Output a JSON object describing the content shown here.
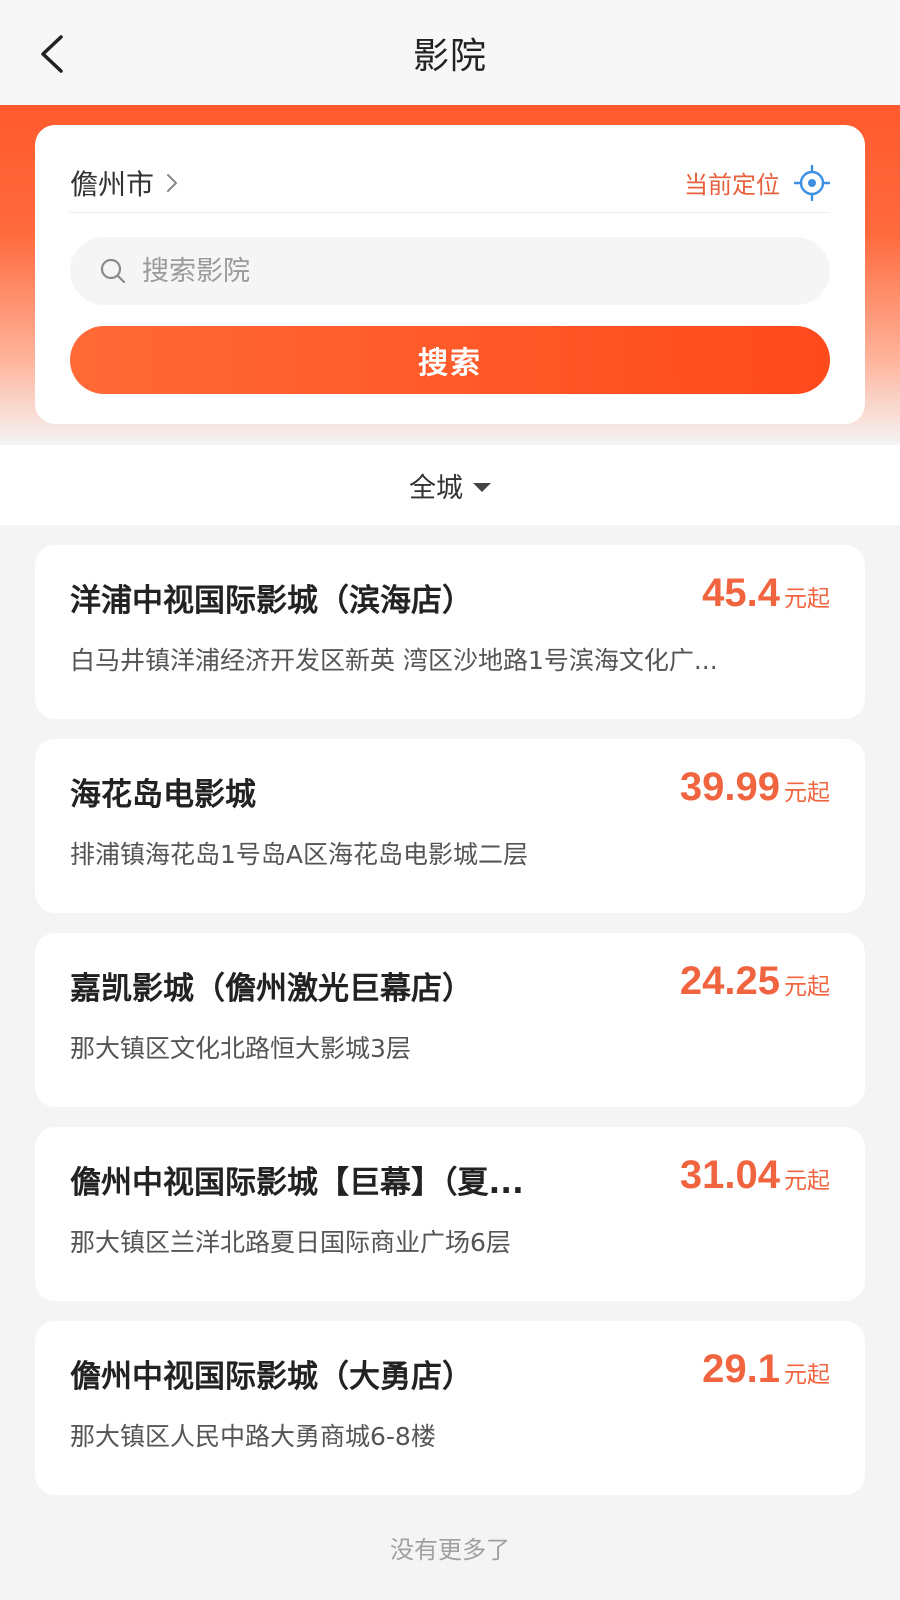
{
  "nav": {
    "title": "影院",
    "back_icon": "chevron-left-icon"
  },
  "header": {
    "city": "儋州市",
    "city_chevron_icon": "chevron-right-icon",
    "locate_label": "当前定位",
    "locate_icon": "crosshair-icon",
    "search": {
      "placeholder": "搜索影院",
      "value": "",
      "icon": "search-icon"
    },
    "search_button_label": "搜索",
    "accent_color": "#ff5a2e"
  },
  "filter": {
    "area_label": "全城",
    "icon": "caret-down-icon"
  },
  "cinemas": [
    {
      "name": "洋浦中视国际影城（滨海店）",
      "price": "45.4",
      "price_suffix": "元起",
      "address": "白马井镇洋浦经济开发区新英 湾区沙地路1号滨海文化广..."
    },
    {
      "name": "海花岛电影城",
      "price": "39.99",
      "price_suffix": "元起",
      "address": "排浦镇海花岛1号岛A区海花岛电影城二层"
    },
    {
      "name": "嘉凯影城（儋州激光巨幕店）",
      "price": "24.25",
      "price_suffix": "元起",
      "address": "那大镇区文化北路恒大影城3层"
    },
    {
      "name": "儋州中视国际影城【巨幕】（夏...",
      "price": "31.04",
      "price_suffix": "元起",
      "address": "那大镇区兰洋北路夏日国际商业广场6层"
    },
    {
      "name": "儋州中视国际影城（大勇店）",
      "price": "29.1",
      "price_suffix": "元起",
      "address": "那大镇区人民中路大勇商城6-8楼"
    }
  ],
  "footer_text": "没有更多了",
  "price_color": "#f0643f"
}
